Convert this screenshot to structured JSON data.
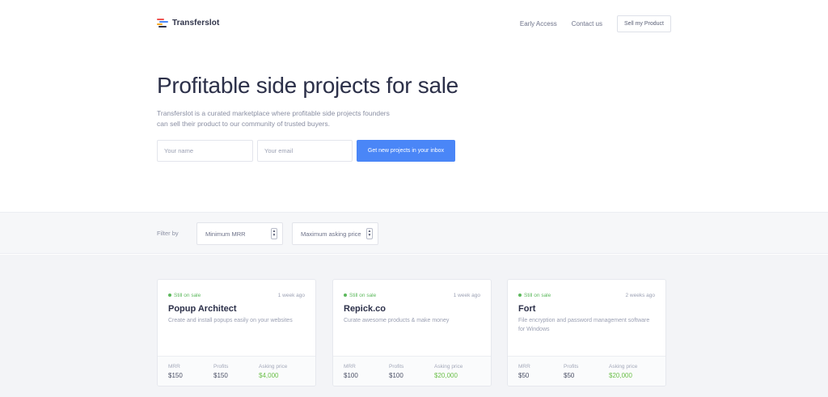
{
  "brand": {
    "name": "Transferslot",
    "logo_colors": [
      "#ef5350",
      "#4a86f7",
      "#f5a623",
      "#2c3049"
    ]
  },
  "nav": {
    "early_access": "Early Access",
    "contact": "Contact us",
    "sell": "Sell my Product"
  },
  "hero": {
    "title": "Profitable side projects for sale",
    "description": "Transferslot is a curated marketplace where profitable side projects founders can sell their product to our community of trusted buyers.",
    "name_placeholder": "Your name",
    "email_placeholder": "Your email",
    "cta": "Get new projects in your inbox"
  },
  "filter": {
    "label": "Filter by",
    "min_mrr": "Minimum MRR",
    "max_price": "Maximum asking price"
  },
  "colors": {
    "accent": "#4a86f7",
    "success": "#5cb85c",
    "price": "#6cc04a"
  },
  "labels": {
    "mrr": "MRR",
    "profits": "Profits",
    "asking": "Asking price"
  },
  "listings": [
    {
      "status": "Still on sale",
      "age": "1 week ago",
      "title": "Popup Architect",
      "description": "Create and install popups easily on your websites",
      "mrr": "$150",
      "profits": "$150",
      "asking": "$4,000"
    },
    {
      "status": "Still on sale",
      "age": "1 week ago",
      "title": "Repick.co",
      "description": "Curate awesome products & make money",
      "mrr": "$100",
      "profits": "$100",
      "asking": "$20,000"
    },
    {
      "status": "Still on sale",
      "age": "2 weeks ago",
      "title": "Fort",
      "description": "File encryption and password management software for Windows",
      "mrr": "$50",
      "profits": "$50",
      "asking": "$20,000"
    }
  ]
}
